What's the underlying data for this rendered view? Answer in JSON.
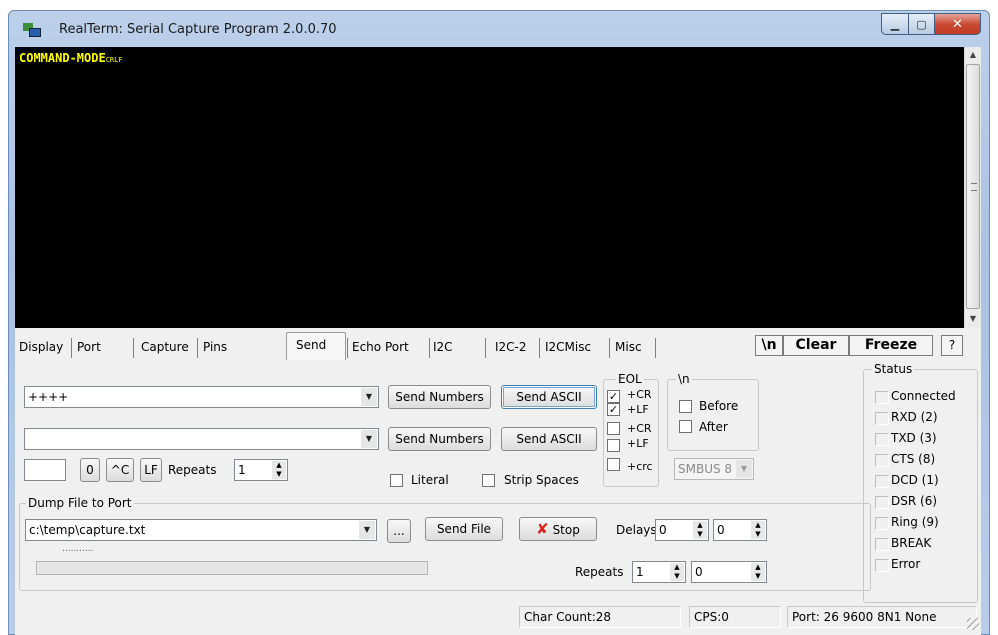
{
  "window": {
    "title": "RealTerm: Serial Capture Program 2.0.0.70"
  },
  "terminal": {
    "text": "COMMAND-MODE",
    "crlf_glyph": "CRLF"
  },
  "tabs": [
    {
      "label": "Display"
    },
    {
      "label": "Port"
    },
    {
      "label": "Capture"
    },
    {
      "label": "Pins"
    },
    {
      "label": "Send"
    },
    {
      "label": "Echo Port"
    },
    {
      "label": "I2C"
    },
    {
      "label": "I2C-2"
    },
    {
      "label": "I2CMisc"
    },
    {
      "label": "Misc"
    }
  ],
  "toolbar": {
    "newline": "\\n",
    "clear": "Clear",
    "freeze": "Freeze",
    "help": "?"
  },
  "send": {
    "line1_value": "++++",
    "line2_value": "",
    "send_numbers_1": "Send Numbers",
    "send_ascii_1": "Send ASCII",
    "send_numbers_2": "Send Numbers",
    "send_ascii_2": "Send ASCII",
    "num_value": "",
    "zero_btn": "0",
    "ctrl_btn": "^C",
    "lf_btn": "LF",
    "repeats_label": "Repeats",
    "repeats_value": "1",
    "literal_label": "Literal",
    "strip_spaces_label": "Strip Spaces"
  },
  "eol": {
    "title": "EOL",
    "cr1": "+CR",
    "lf1": "+LF",
    "cr2": "+CR",
    "lf2": "+LF",
    "crc": "+crc",
    "cr1_checked": true,
    "lf1_checked": true,
    "cr2_checked": false,
    "lf2_checked": false,
    "crc_checked": false
  },
  "newline_group": {
    "title": "\\n",
    "before": "Before",
    "after": "After",
    "smbus": "SMBUS 8"
  },
  "dump": {
    "title": "Dump File to Port",
    "file_path": "c:\\temp\\capture.txt",
    "browse": "...",
    "send_file": "Send File",
    "stop": "Stop",
    "delays_label": "Delays",
    "delay1": "0",
    "delay2": "0",
    "repeats_label": "Repeats",
    "repeats1": "1",
    "repeats2": "0",
    "progress_dots": "...........",
    "progress": 0
  },
  "status": {
    "title": "Status",
    "items": [
      {
        "label": "Connected"
      },
      {
        "label": "RXD (2)"
      },
      {
        "label": "TXD (3)"
      },
      {
        "label": "CTS (8)"
      },
      {
        "label": "DCD (1)"
      },
      {
        "label": "DSR (6)"
      },
      {
        "label": "Ring (9)"
      },
      {
        "label": "BREAK"
      },
      {
        "label": "Error"
      }
    ]
  },
  "statusbar": {
    "char_count": "Char Count:28",
    "cps": "CPS:0",
    "port": "Port: 26 9600 8N1 None"
  },
  "colors": {
    "terminal_bg": "#000000",
    "terminal_text": "#ffff00",
    "stop_icon": "#d8261c"
  }
}
